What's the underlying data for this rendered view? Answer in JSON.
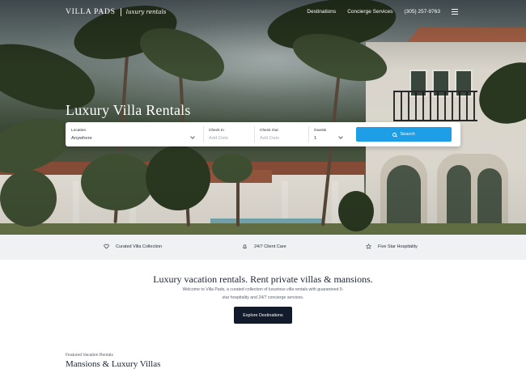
{
  "brand": {
    "name": "VILLA PADS",
    "tagline": "luxury rentals"
  },
  "nav": {
    "links": [
      "Destinations",
      "Concierge Services"
    ],
    "phone": "(305) 257-9763",
    "menu_icon": "hamburger-icon"
  },
  "hero": {
    "title": "Luxury Villa Rentals",
    "search": {
      "location": {
        "label": "Location",
        "value": "Anywhere"
      },
      "check_in": {
        "label": "Check In",
        "placeholder": "Add Date"
      },
      "check_out": {
        "label": "Check Out",
        "placeholder": "Add Date"
      },
      "guests": {
        "label": "Guests",
        "value": "1"
      },
      "button_label": "Search",
      "button_color": "#1e9ee6"
    }
  },
  "features": [
    {
      "icon": "heart-icon",
      "label": "Curated Villa Collection"
    },
    {
      "icon": "bell-icon",
      "label": "24/7 Client Care"
    },
    {
      "icon": "star-icon",
      "label": "Five Star Hospitality"
    }
  ],
  "intro": {
    "title": "Luxury vacation rentals. Rent private villas & mansions.",
    "text": "Welcome to Villa Pads, a curated collection of luxurious villa rentals with guaranteed 5-star hospitality and 24/7 concierge services.",
    "cta_label": "Explore Destinations",
    "cta_color": "#111b2c"
  },
  "featured": {
    "eyebrow": "Featured Vacation Rentals",
    "heading": "Mansions & Luxury Villas"
  }
}
